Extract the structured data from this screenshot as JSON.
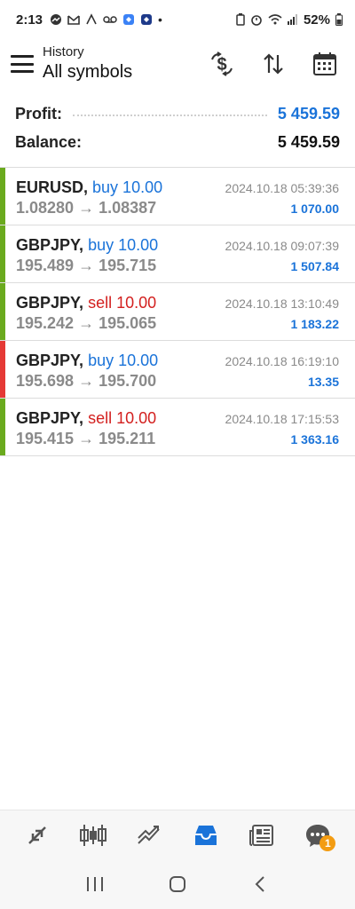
{
  "status_bar": {
    "time": "2:13",
    "battery": "52%"
  },
  "header": {
    "subtitle": "History",
    "title": "All symbols",
    "icons": [
      "currency-swap-icon",
      "sort-icon",
      "calendar-icon"
    ]
  },
  "summary": {
    "profit_label": "Profit:",
    "profit_value": "5 459.59",
    "balance_label": "Balance:",
    "balance_value": "5 459.59"
  },
  "trades": [
    {
      "symbol": "EURUSD,",
      "side": "buy 10.00",
      "prices": "1.08280 → 1.08387",
      "time": "2024.10.18 05:39:36",
      "profit": "1 070.00",
      "bar_color": "#6aaa1e",
      "side_type": "buy"
    },
    {
      "symbol": "GBPJPY,",
      "side": "buy 10.00",
      "prices": "195.489 → 195.715",
      "time": "2024.10.18 09:07:39",
      "profit": "1 507.84",
      "bar_color": "#6aaa1e",
      "side_type": "buy"
    },
    {
      "symbol": "GBPJPY,",
      "side": "sell 10.00",
      "prices": "195.242 → 195.065",
      "time": "2024.10.18 13:10:49",
      "profit": "1 183.22",
      "bar_color": "#6aaa1e",
      "side_type": "sell"
    },
    {
      "symbol": "GBPJPY,",
      "side": "buy 10.00",
      "prices": "195.698 → 195.700",
      "time": "2024.10.18 16:19:10",
      "profit": "13.35",
      "bar_color": "#e53935",
      "side_type": "buy"
    },
    {
      "symbol": "GBPJPY,",
      "side": "sell 10.00",
      "prices": "195.415 → 195.211",
      "time": "2024.10.18 17:15:53",
      "profit": "1 363.16",
      "bar_color": "#6aaa1e",
      "side_type": "sell"
    }
  ],
  "bottom_nav": {
    "items": [
      "quotes-icon",
      "chart-icon",
      "trade-icon",
      "history-icon",
      "news-icon",
      "messages-icon"
    ],
    "active": "history-icon",
    "badge": "1"
  },
  "colors": {
    "accent": "#1a73d9",
    "sell": "#d3201f",
    "green": "#6aaa1e",
    "red": "#e53935"
  }
}
